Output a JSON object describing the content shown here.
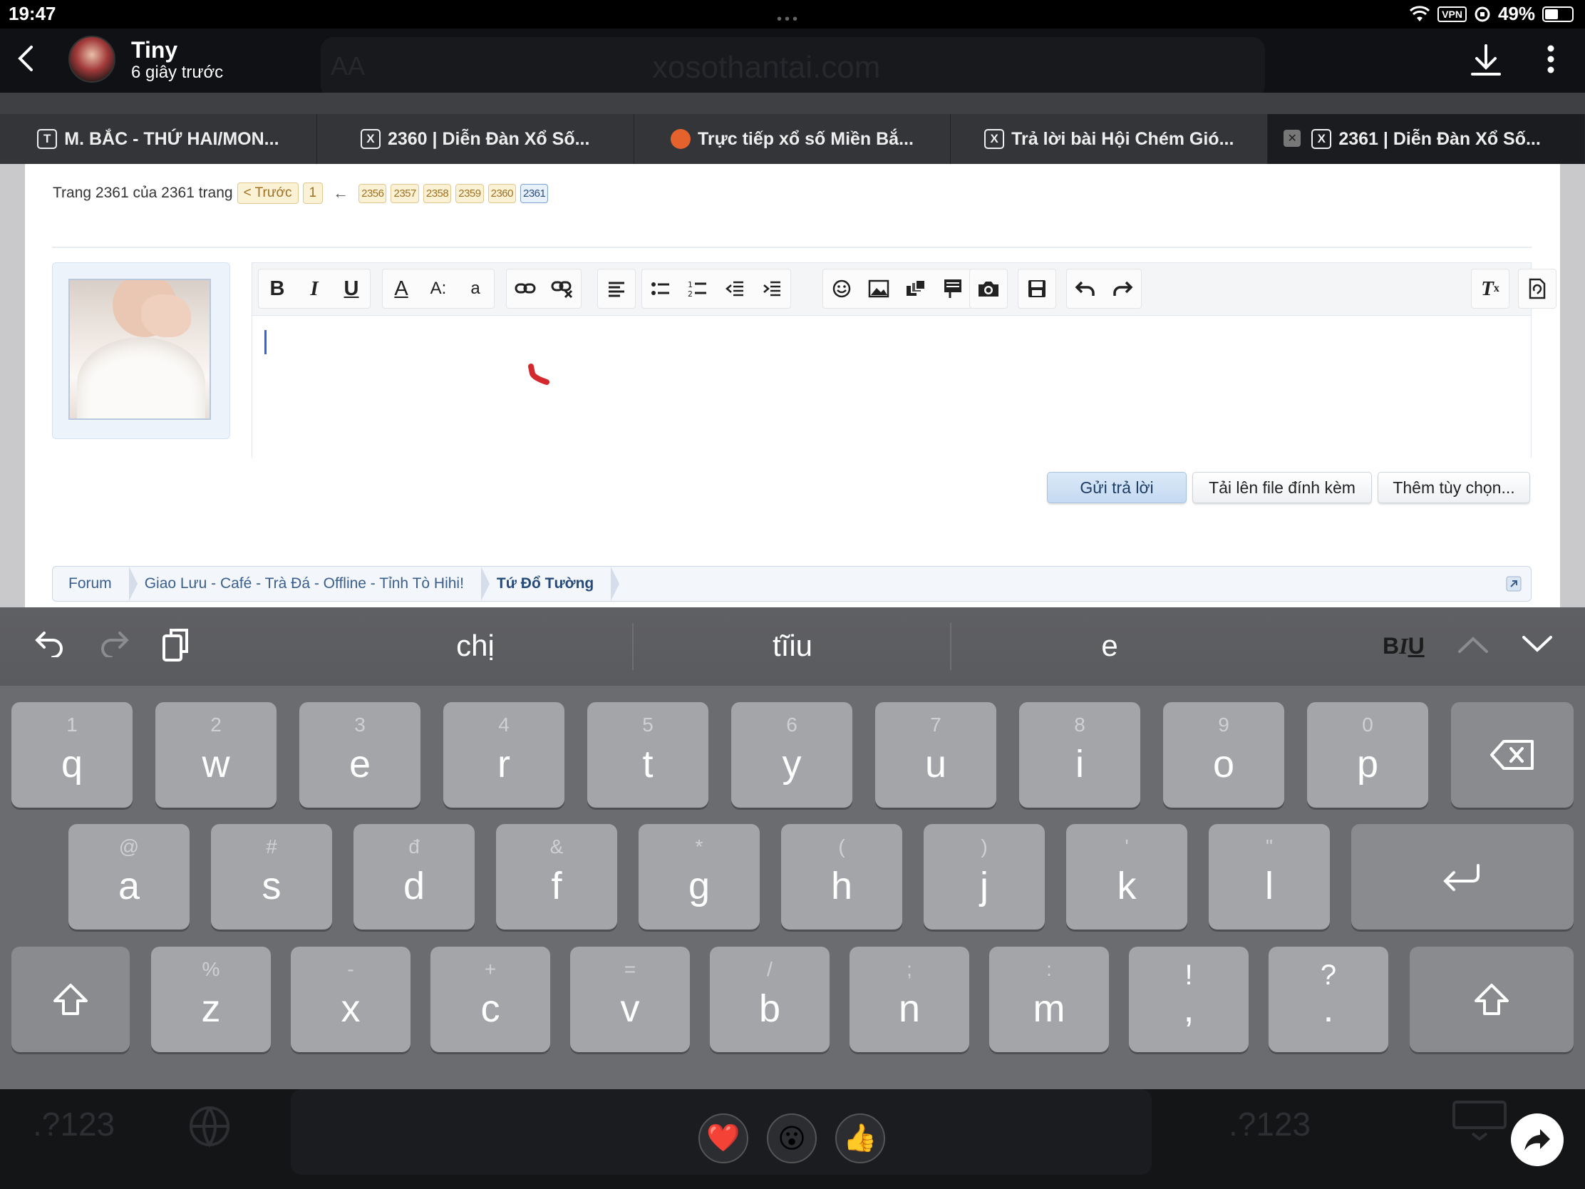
{
  "status_bar": {
    "time": "19:47",
    "vpn": "VPN",
    "battery": "49%",
    "battery_level": 0.49
  },
  "story": {
    "user_name": "Tiny",
    "posted_time": "6 giây trước",
    "background_url": "xosothantai.com",
    "background_aa": "AA"
  },
  "tabs": [
    {
      "favicon": "T",
      "title": "M. BẮC - THỨ HAI/MON..."
    },
    {
      "favicon": "X",
      "title": "2360 | Diễn Đàn Xổ Số..."
    },
    {
      "favicon": "",
      "title": "Trực tiếp xổ số Miền Bắ..."
    },
    {
      "favicon": "X",
      "title": "Trả lời bài Hội Chém Gió..."
    },
    {
      "favicon": "X",
      "title": "2361 | Diễn Đàn Xổ Số...",
      "active": true
    }
  ],
  "pagination": {
    "label": "Trang 2361 của 2361 trang",
    "prev": "< Trước",
    "first": "1",
    "arrow": "←",
    "pages": [
      "2356",
      "2357",
      "2358",
      "2359",
      "2360",
      "2361"
    ],
    "current": "2361"
  },
  "editor": {
    "toolbar": {
      "bold": "B",
      "italic": "I",
      "underline": "U",
      "font_color": "A",
      "font_size": "A:",
      "font_family": "a",
      "clear_format": "T"
    }
  },
  "buttons": {
    "reply": "Gửi trả lời",
    "upload": "Tải lên file đính kèm",
    "more_options": "Thêm tùy chọn..."
  },
  "breadcrumb": [
    "Forum",
    "Giao Lưu - Café - Trà Đá - Offline - Tỉnh Tò Hihi!",
    "Tứ Đổ Tường"
  ],
  "keyboard": {
    "suggestions": [
      "chị",
      "tĩiu",
      "e"
    ],
    "format_label": {
      "b": "B",
      "i": "I",
      "u": "U"
    },
    "row1": [
      {
        "hint": "1",
        "key": "q"
      },
      {
        "hint": "2",
        "key": "w"
      },
      {
        "hint": "3",
        "key": "e"
      },
      {
        "hint": "4",
        "key": "r"
      },
      {
        "hint": "5",
        "key": "t"
      },
      {
        "hint": "6",
        "key": "y"
      },
      {
        "hint": "7",
        "key": "u"
      },
      {
        "hint": "8",
        "key": "i"
      },
      {
        "hint": "9",
        "key": "o"
      },
      {
        "hint": "0",
        "key": "p"
      }
    ],
    "row2": [
      {
        "hint": "@",
        "key": "a"
      },
      {
        "hint": "#",
        "key": "s"
      },
      {
        "hint": "đ",
        "key": "d"
      },
      {
        "hint": "&",
        "key": "f"
      },
      {
        "hint": "*",
        "key": "g"
      },
      {
        "hint": "(",
        "key": "h"
      },
      {
        "hint": ")",
        "key": "j"
      },
      {
        "hint": "'",
        "key": "k"
      },
      {
        "hint": "\"",
        "key": "l"
      }
    ],
    "row3": [
      {
        "hint": "%",
        "key": "z"
      },
      {
        "hint": "-",
        "key": "x"
      },
      {
        "hint": "+",
        "key": "c"
      },
      {
        "hint": "=",
        "key": "v"
      },
      {
        "hint": "/",
        "key": "b"
      },
      {
        "hint": ";",
        "key": "n"
      },
      {
        "hint": ":",
        "key": "m"
      },
      {
        "hint": "!",
        "key": ","
      },
      {
        "hint": "?",
        "key": "."
      }
    ],
    "numbers_key": ".?123"
  },
  "reactions": [
    "❤️",
    "😮",
    "👍"
  ]
}
